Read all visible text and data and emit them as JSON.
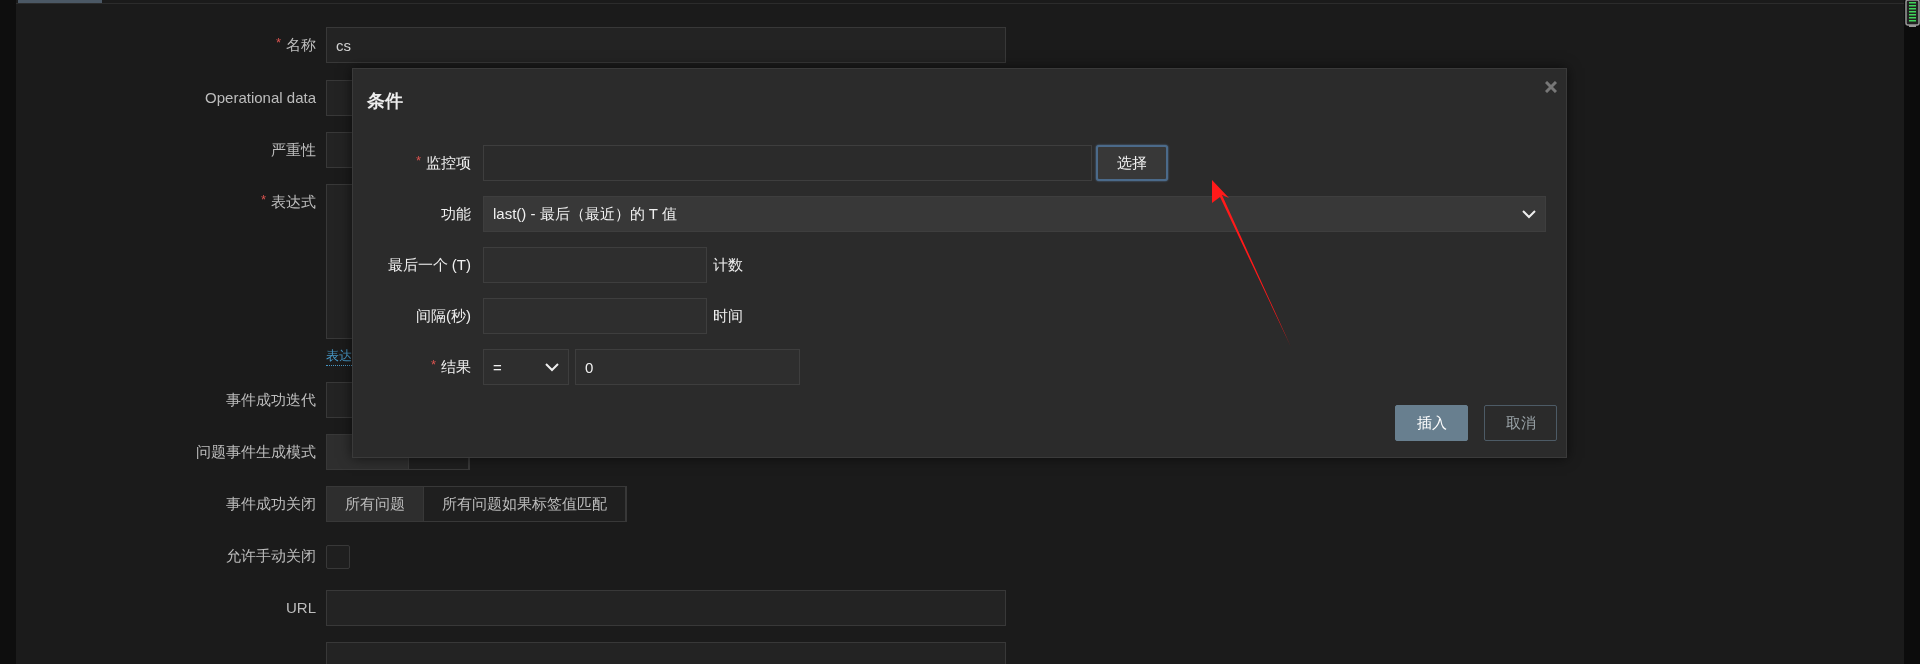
{
  "form": {
    "fields": [
      {
        "kind": "input",
        "label": "名称",
        "marker": "*",
        "value": "cs"
      },
      {
        "kind": "input",
        "label": "Operational data"
      },
      {
        "kind": "box",
        "label": "严重性"
      },
      {
        "kind": "textarea",
        "label": "表达式",
        "marker": "*"
      },
      {
        "kind": "link",
        "text": "表达"
      },
      {
        "kind": "box",
        "label": "事件成功迭代"
      },
      {
        "kind": "segmented",
        "label": "问题事件生成模式",
        "options": [
          {
            "selected": true
          },
          {
            "selected": false
          }
        ]
      },
      {
        "kind": "segmented",
        "label": "事件成功关闭",
        "options": [
          {
            "label": "所有问题",
            "selected": true
          },
          {
            "label": "所有问题如果标签值匹配",
            "selected": false
          }
        ]
      },
      {
        "kind": "checkbox",
        "label": "允许手动关闭",
        "checked": false
      },
      {
        "kind": "input",
        "label": "URL"
      },
      {
        "kind": "input"
      }
    ]
  },
  "dialog": {
    "title": "条件",
    "rows": [
      {
        "kind": "item",
        "label": "监控项",
        "marker": "*",
        "button": "选择"
      },
      {
        "kind": "select",
        "label": "功能",
        "value": "last() - 最后（最近）的 T 值"
      },
      {
        "kind": "input",
        "label": "最后一个 (T)",
        "suffix": "计数"
      },
      {
        "kind": "input",
        "label": "间隔(秒)",
        "suffix": "时间"
      },
      {
        "kind": "result",
        "label": "结果",
        "marker": "*",
        "operator": "=",
        "value": "0"
      }
    ],
    "buttons": [
      {
        "label": "插入",
        "kind": "primary"
      },
      {
        "label": "取消",
        "kind": "secondary"
      }
    ]
  }
}
